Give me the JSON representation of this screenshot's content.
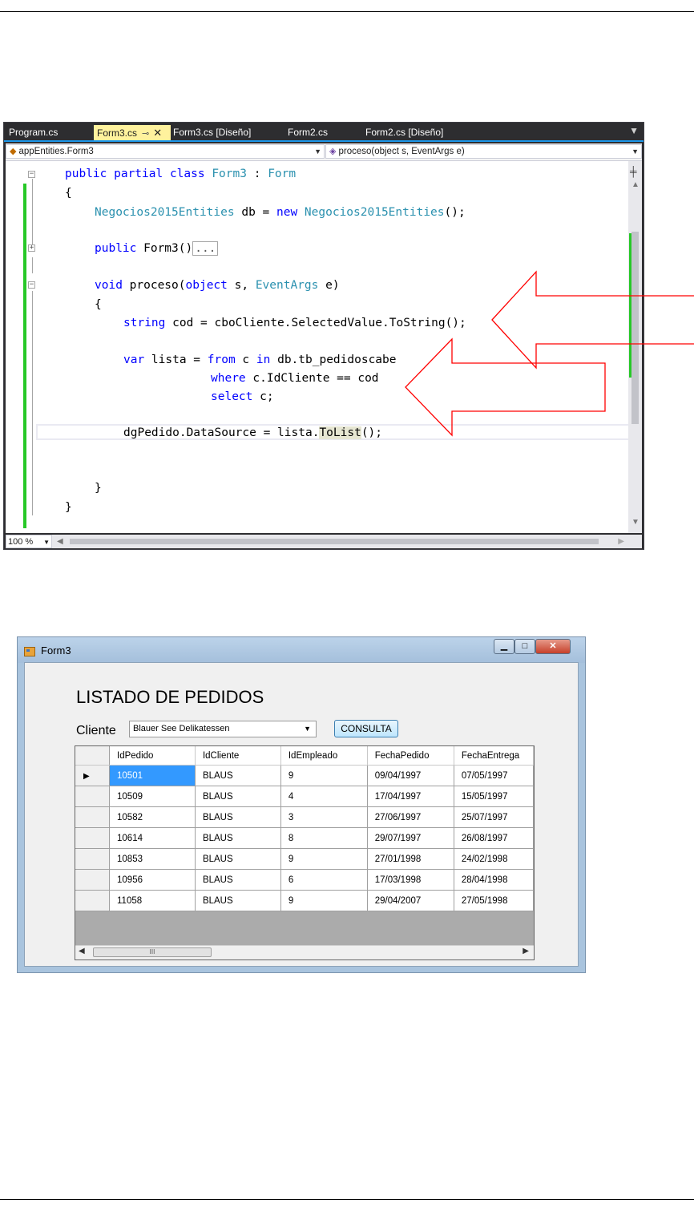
{
  "vs": {
    "tabs": [
      {
        "label": "Program.cs"
      },
      {
        "label": "Form3.cs",
        "pin": "⊸",
        "close": "✕"
      },
      {
        "label": "Form3.cs [Diseño]"
      },
      {
        "label": "Form2.cs"
      },
      {
        "label": "Form2.cs [Diseño]"
      }
    ],
    "nav_class": "appEntities.Form3",
    "nav_member": "proceso(object s, EventArgs e)",
    "zoom": "100 %",
    "code": {
      "l1_kw": "public partial class ",
      "l1_ty": "Form3",
      "l1_mid": " : ",
      "l1_ty2": "Form",
      "l2": "{",
      "l3_ty": "Negocios2015Entities",
      "l3_mid": " db = ",
      "l3_kw": "new ",
      "l3_ty2": "Negocios2015Entities",
      "l3_end": "();",
      "l4_kw": "public ",
      "l4_mid": "Form3()",
      "l4_collapsed": "...",
      "l5_kw": "void ",
      "l5_mid": "proceso(",
      "l5_kw2": "object ",
      "l5_mid2": "s, ",
      "l5_ty": "EventArgs",
      "l5_end": " e)",
      "l6": "{",
      "l7_kw": "string ",
      "l7_rest": "cod = cboCliente.SelectedValue.ToString();",
      "l8_kw": "var ",
      "l8_mid": "lista = ",
      "l8_kw2": "from ",
      "l8_mid2": "c ",
      "l8_kw3": "in ",
      "l8_rest": "db.tb_pedidoscabe",
      "l9_kw": "where ",
      "l9_rest": "c.IdCliente == cod",
      "l10_kw": "select ",
      "l10_rest": "c;",
      "l11_pre": "dgPedido.DataSource = lista.",
      "l11_hl": "ToList",
      "l11_end": "();",
      "l12": "}",
      "l13": "}"
    }
  },
  "form3": {
    "window_title": "Form3",
    "heading": "LISTADO DE PEDIDOS",
    "cliente_label": "Cliente",
    "cliente_value": "Blauer See Delikatessen",
    "consulta_button": "CONSULTA",
    "win_buttons": {
      "minimize": "▁",
      "maximize": "□",
      "close": "✕"
    },
    "grid": {
      "columns": [
        "IdPedido",
        "IdCliente",
        "IdEmpleado",
        "FechaPedido",
        "FechaEntrega"
      ],
      "rows": [
        [
          "10501",
          "BLAUS",
          "9",
          "09/04/1997",
          "07/05/1997"
        ],
        [
          "10509",
          "BLAUS",
          "4",
          "17/04/1997",
          "15/05/1997"
        ],
        [
          "10582",
          "BLAUS",
          "3",
          "27/06/1997",
          "25/07/1997"
        ],
        [
          "10614",
          "BLAUS",
          "8",
          "29/07/1997",
          "26/08/1997"
        ],
        [
          "10853",
          "BLAUS",
          "9",
          "27/01/1998",
          "24/02/1998"
        ],
        [
          "10956",
          "BLAUS",
          "6",
          "17/03/1998",
          "28/04/1998"
        ],
        [
          "11058",
          "BLAUS",
          "9",
          "29/04/2007",
          "27/05/1998"
        ]
      ],
      "current_row_marker": "▶",
      "scroll_thumb_grip": "III"
    }
  },
  "colors": {
    "vs_tab_active": "#fff29d",
    "keyword": "#0000ff",
    "type": "#2b91af",
    "annotation_arrow": "#ff0000",
    "grid_selection": "#3399ff"
  }
}
